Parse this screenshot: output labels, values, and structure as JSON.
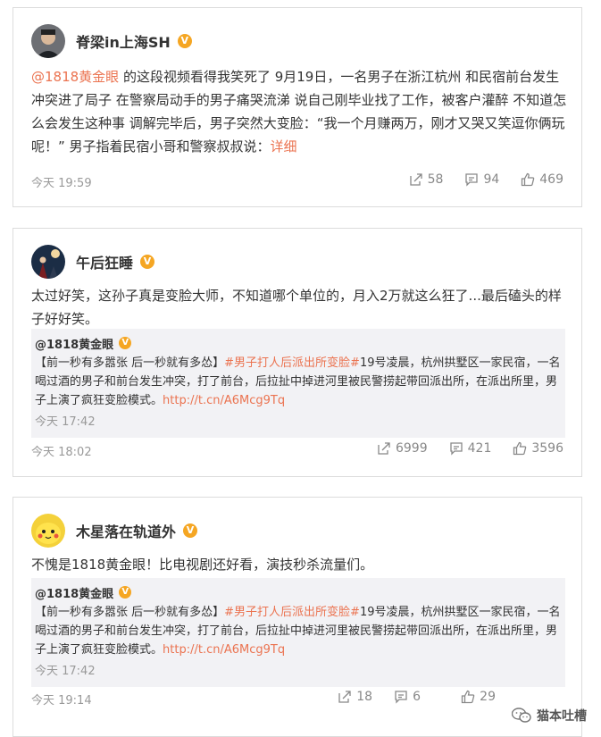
{
  "posts": [
    {
      "user": "脊梁in上海SH",
      "mention": "@1818黄金眼",
      "text": " 的这段视频看得我笑死了 9月19日，一名男子在浙江杭州 和民宿前台发生冲突进了局子 在警察局动手的男子痛哭流涕 说自己刚毕业找了工作，被客户灌醉 不知道怎么会发生这种事 调解完毕后，男子突然大变脸：“我一个月赚两万，刚才又哭又笑逗你俩玩呢！” 男子指着民宿小哥和警察叔叔说：",
      "more": "详细",
      "time": "今天 19:59",
      "share": "58",
      "comment": "94",
      "like": "469"
    },
    {
      "user": "午后狂睡",
      "text": "太过好笑，这孙子真是变脸大师，不知道哪个单位的，月入2万就这么狂了...最后磕头的样子好好笑。",
      "quote": {
        "user": "@1818黄金眼",
        "pre": "【前一秒有多嚣张 后一秒就有多怂】",
        "tag": "#男子打人后派出所变脸#",
        "body": "19号凌晨，杭州拱墅区一家民宿，一名喝过酒的男子和前台发生冲突，打了前台，后拉扯中掉进河里被民警捞起带回派出所，在派出所里，男子上演了疯狂变脸模式。",
        "url": "http://t.cn/A6Mcg9Tq",
        "time": "今天 17:42"
      },
      "time": "今天 18:02",
      "share": "6999",
      "comment": "421",
      "like": "3596"
    },
    {
      "user": "木星落在轨道外",
      "text": "不愧是1818黄金眼！比电视剧还好看，演技秒杀流量们。",
      "quote": {
        "user": "@1818黄金眼",
        "pre": "【前一秒有多嚣张 后一秒就有多怂】",
        "tag": "#男子打人后派出所变脸#",
        "body": "19号凌晨，杭州拱墅区一家民宿，一名喝过酒的男子和前台发生冲突，打了前台，后拉扯中掉进河里被民警捞起带回派出所，在派出所里，男子上演了疯狂变脸模式。",
        "url": "http://t.cn/A6Mcg9Tq",
        "time": "今天 17:42"
      },
      "time": "今天 19:14",
      "share": "18",
      "comment": "6",
      "like": "29"
    }
  ],
  "watermark": "猫本吐槽",
  "colors": {
    "link": "#eb7350",
    "badge": "#f5a623"
  }
}
